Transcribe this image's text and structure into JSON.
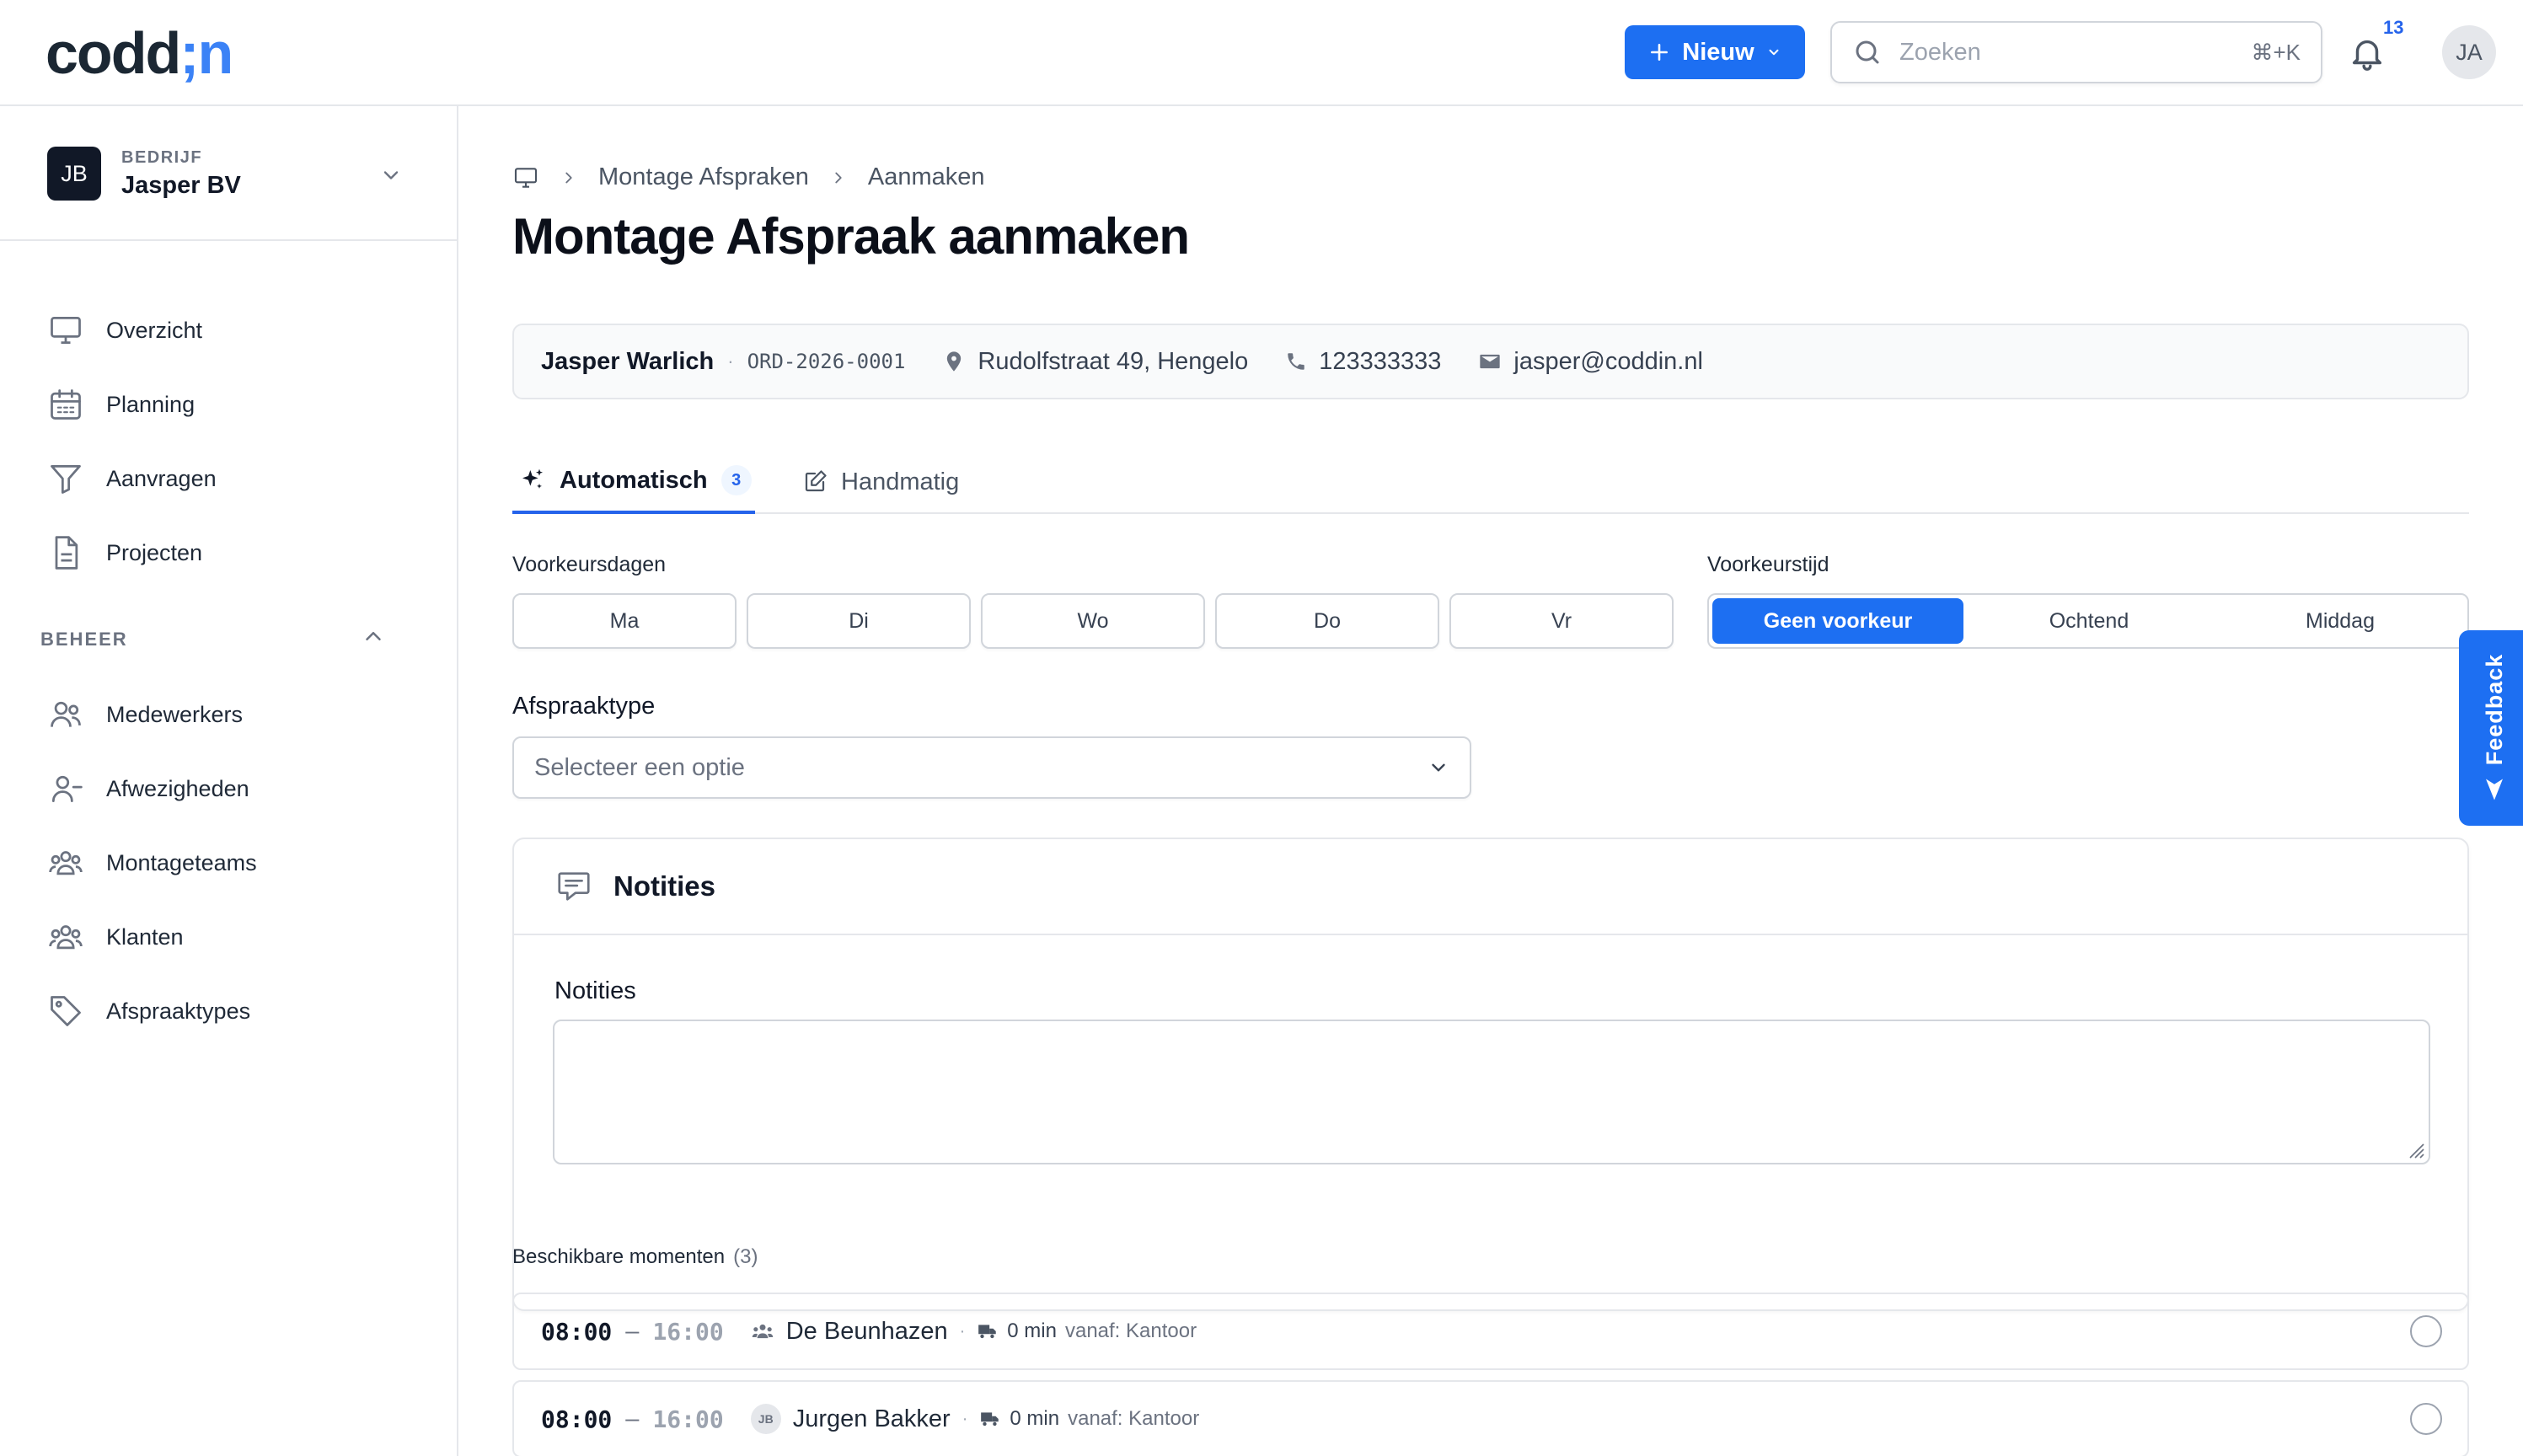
{
  "app": {
    "logo_part1": "codd",
    "logo_part2": ";n",
    "new_button": "Nieuw",
    "search_placeholder": "Zoeken",
    "search_shortcut": "⌘+K",
    "notification_count": "13",
    "user_initials": "JA",
    "accent_color": "#1d6ff2"
  },
  "sidebar": {
    "company_initials": "JB",
    "company_label": "BEDRIJF",
    "company_name": "Jasper BV",
    "items": [
      {
        "label": "Overzicht",
        "icon": "monitor-icon"
      },
      {
        "label": "Planning",
        "icon": "calendar-icon"
      },
      {
        "label": "Aanvragen",
        "icon": "filter-icon"
      },
      {
        "label": "Projecten",
        "icon": "document-icon"
      }
    ],
    "section_label": "BEHEER",
    "admin_items": [
      {
        "label": "Medewerkers",
        "icon": "users-icon"
      },
      {
        "label": "Afwezigheden",
        "icon": "user-minus-icon"
      },
      {
        "label": "Montageteams",
        "icon": "team-icon"
      },
      {
        "label": "Klanten",
        "icon": "customers-icon"
      },
      {
        "label": "Afspraaktypes",
        "icon": "tag-icon"
      }
    ]
  },
  "breadcrumb": {
    "items": [
      "Montage Afspraken",
      "Aanmaken"
    ]
  },
  "page": {
    "title": "Montage Afspraak aanmaken"
  },
  "customer": {
    "name": "Jasper Warlich",
    "order": "ORD-2026-0001",
    "address": "Rudolfstraat 49, Hengelo",
    "phone": "123333333",
    "email": "jasper@coddin.nl"
  },
  "tabs": [
    {
      "label": "Automatisch",
      "count": "3",
      "active": true
    },
    {
      "label": "Handmatig",
      "active": false
    }
  ],
  "preferences": {
    "days_label": "Voorkeursdagen",
    "days": [
      "Ma",
      "Di",
      "Wo",
      "Do",
      "Vr"
    ],
    "time_label": "Voorkeurstijd",
    "times": [
      "Geen voorkeur",
      "Ochtend",
      "Middag"
    ],
    "selected_time": "Geen voorkeur"
  },
  "appointment_type": {
    "label": "Afspraaktype",
    "placeholder": "Selecteer een optie"
  },
  "notes": {
    "card_title": "Notities",
    "field_label": "Notities",
    "value": ""
  },
  "available": {
    "label": "Beschikbare momenten",
    "count": "(3)",
    "slots": [
      {
        "start": "08:00",
        "end": "16:00",
        "team": "De Beunhazen",
        "team_type": "team",
        "travel": "0 min",
        "from": "vanaf: Kantoor"
      },
      {
        "start": "08:00",
        "end": "16:00",
        "team": "Jurgen Bakker",
        "team_type": "person",
        "initials": "JB",
        "travel": "0 min",
        "from": "vanaf: Kantoor"
      }
    ]
  },
  "feedback": {
    "label": "Feedback"
  }
}
